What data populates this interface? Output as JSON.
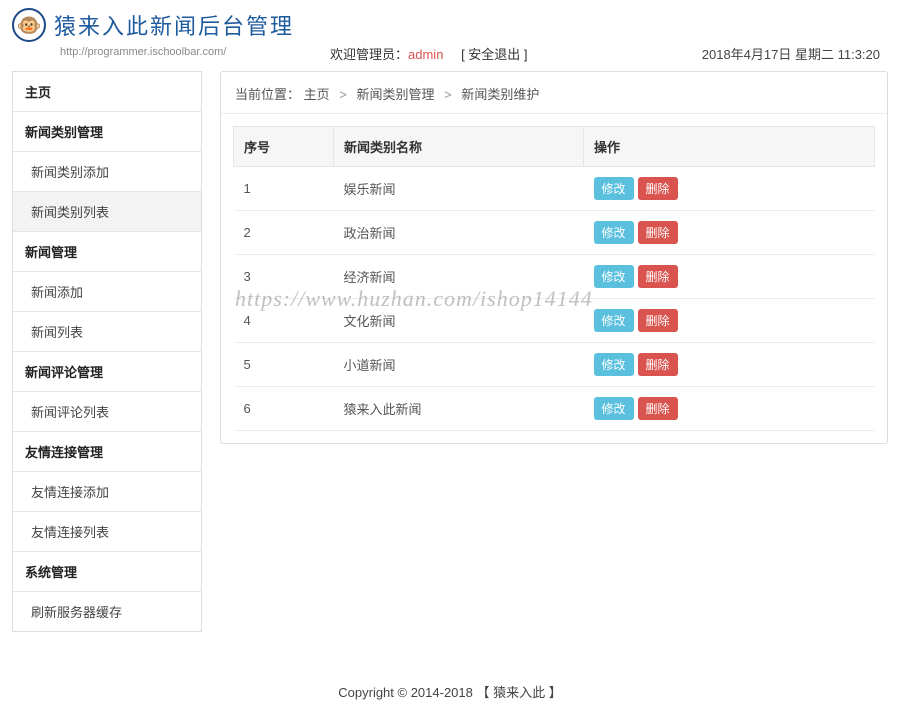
{
  "header": {
    "site_title": "猿来入此新闻后台管理",
    "site_url": "http://programmer.ischoolbar.com/",
    "welcome_prefix": "欢迎管理员：",
    "admin_name": "admin",
    "logout_label": "[  安全退出  ]",
    "datetime": "2018年4月17日  星期二  11:3:20"
  },
  "sidebar": {
    "home": "主页",
    "cat_mgmt": "新闻类别管理",
    "cat_add": "新闻类别添加",
    "cat_list": "新闻类别列表",
    "news_mgmt": "新闻管理",
    "news_add": "新闻添加",
    "news_list": "新闻列表",
    "comment_mgmt": "新闻评论管理",
    "comment_list": "新闻评论列表",
    "link_mgmt": "友情连接管理",
    "link_add": "友情连接添加",
    "link_list": "友情连接列表",
    "sys_mgmt": "系统管理",
    "refresh_cache": "刷新服务器缓存"
  },
  "breadcrumb": {
    "label": "当前位置：",
    "p0": "主页",
    "p1": "新闻类别管理",
    "p2": "新闻类别维护"
  },
  "table": {
    "col_index": "序号",
    "col_name": "新闻类别名称",
    "col_action": "操作",
    "edit_label": "修改",
    "delete_label": "删除",
    "rows": [
      {
        "idx": "1",
        "name": "娱乐新闻"
      },
      {
        "idx": "2",
        "name": "政治新闻"
      },
      {
        "idx": "3",
        "name": "经济新闻"
      },
      {
        "idx": "4",
        "name": "文化新闻"
      },
      {
        "idx": "5",
        "name": "小道新闻"
      },
      {
        "idx": "6",
        "name": "猿来入此新闻"
      }
    ]
  },
  "footer": {
    "copyright": "Copyright © 2014-2018 【 猿来入此 】"
  },
  "watermark": "https://www.huzhan.com/ishop14144"
}
